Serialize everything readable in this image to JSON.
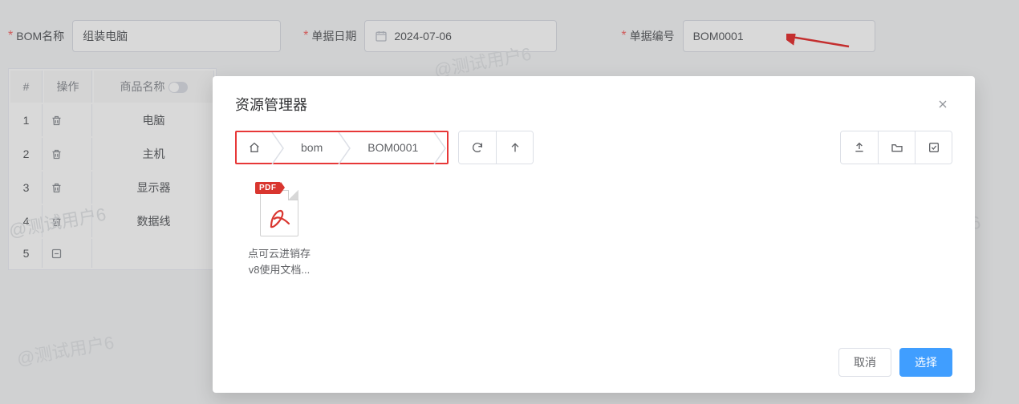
{
  "form": {
    "bom_name_label": "BOM名称",
    "bom_name_value": "组装电脑",
    "date_label": "单据日期",
    "date_value": "2024-07-06",
    "code_label": "单据编号",
    "code_value": "BOM0001"
  },
  "table": {
    "headers": {
      "idx": "#",
      "op": "操作",
      "name": "商品名称"
    },
    "rows": [
      {
        "idx": "1",
        "name": "电脑"
      },
      {
        "idx": "2",
        "name": "主机"
      },
      {
        "idx": "3",
        "name": "显示器"
      },
      {
        "idx": "4",
        "name": "数据线"
      },
      {
        "idx": "5",
        "name": ""
      }
    ]
  },
  "watermark": "@测试用户6",
  "dialog": {
    "title": "资源管理器",
    "breadcrumb": {
      "home": "home",
      "b1": "bom",
      "b2": "BOM0001"
    },
    "toolbar_icons": {
      "refresh": "refresh-icon",
      "up": "up-icon",
      "upload": "upload-icon",
      "folder": "folder-icon",
      "select_all": "select-all-icon"
    },
    "file": {
      "badge": "PDF",
      "name_l1": "点可云进销存",
      "name_l2": "v8使用文档..."
    },
    "buttons": {
      "cancel": "取消",
      "confirm": "选择"
    }
  }
}
